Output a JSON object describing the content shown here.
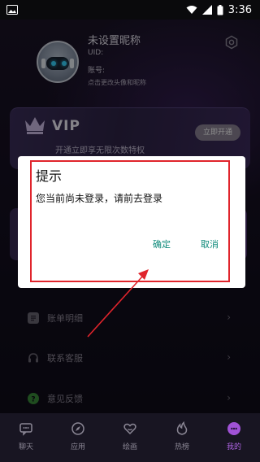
{
  "status_bar": {
    "time": "3:36",
    "icons": [
      "image-icon",
      "wifi-icon",
      "signal-icon",
      "battery-icon"
    ]
  },
  "profile": {
    "nickname": "未设置昵称",
    "uid_label": "UID:",
    "account_label": "账号:",
    "change_hint": "点击更改头像和昵称"
  },
  "vip": {
    "label": "VIP",
    "button_label": "立即开通",
    "description": "开通立即享无限次数特权"
  },
  "menu": {
    "items": [
      {
        "label": "账单明细",
        "icon": "bill-icon"
      },
      {
        "label": "联系客服",
        "icon": "headset-icon"
      },
      {
        "label": "意见反馈",
        "icon": "feedback-icon"
      }
    ]
  },
  "bottom_nav": {
    "items": [
      {
        "label": "聊天",
        "icon": "chat-icon"
      },
      {
        "label": "应用",
        "icon": "compass-icon"
      },
      {
        "label": "绘画",
        "icon": "heart-icon"
      },
      {
        "label": "热榜",
        "icon": "flame-icon"
      },
      {
        "label": "我的",
        "icon": "profile-icon",
        "active": true
      }
    ]
  },
  "dialog": {
    "title": "提示",
    "message": "您当前尚未登录，请前去登录",
    "confirm_label": "确定",
    "cancel_label": "取消"
  },
  "colors": {
    "accent_teal": "#0e8a7a",
    "nav_active": "#b065e6",
    "annotation_red": "#e0242c"
  }
}
